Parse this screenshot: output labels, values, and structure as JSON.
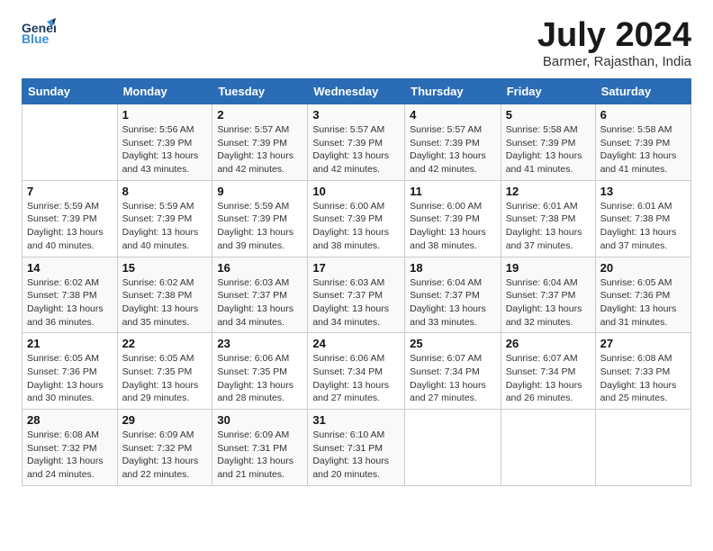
{
  "header": {
    "logo_general": "General",
    "logo_blue": "Blue",
    "month": "July 2024",
    "location": "Barmer, Rajasthan, India"
  },
  "columns": [
    "Sunday",
    "Monday",
    "Tuesday",
    "Wednesday",
    "Thursday",
    "Friday",
    "Saturday"
  ],
  "weeks": [
    [
      {
        "day": "",
        "sunrise": "",
        "sunset": "",
        "daylight": ""
      },
      {
        "day": "1",
        "sunrise": "Sunrise: 5:56 AM",
        "sunset": "Sunset: 7:39 PM",
        "daylight": "Daylight: 13 hours and 43 minutes."
      },
      {
        "day": "2",
        "sunrise": "Sunrise: 5:57 AM",
        "sunset": "Sunset: 7:39 PM",
        "daylight": "Daylight: 13 hours and 42 minutes."
      },
      {
        "day": "3",
        "sunrise": "Sunrise: 5:57 AM",
        "sunset": "Sunset: 7:39 PM",
        "daylight": "Daylight: 13 hours and 42 minutes."
      },
      {
        "day": "4",
        "sunrise": "Sunrise: 5:57 AM",
        "sunset": "Sunset: 7:39 PM",
        "daylight": "Daylight: 13 hours and 42 minutes."
      },
      {
        "day": "5",
        "sunrise": "Sunrise: 5:58 AM",
        "sunset": "Sunset: 7:39 PM",
        "daylight": "Daylight: 13 hours and 41 minutes."
      },
      {
        "day": "6",
        "sunrise": "Sunrise: 5:58 AM",
        "sunset": "Sunset: 7:39 PM",
        "daylight": "Daylight: 13 hours and 41 minutes."
      }
    ],
    [
      {
        "day": "7",
        "sunrise": "Sunrise: 5:59 AM",
        "sunset": "Sunset: 7:39 PM",
        "daylight": "Daylight: 13 hours and 40 minutes."
      },
      {
        "day": "8",
        "sunrise": "Sunrise: 5:59 AM",
        "sunset": "Sunset: 7:39 PM",
        "daylight": "Daylight: 13 hours and 40 minutes."
      },
      {
        "day": "9",
        "sunrise": "Sunrise: 5:59 AM",
        "sunset": "Sunset: 7:39 PM",
        "daylight": "Daylight: 13 hours and 39 minutes."
      },
      {
        "day": "10",
        "sunrise": "Sunrise: 6:00 AM",
        "sunset": "Sunset: 7:39 PM",
        "daylight": "Daylight: 13 hours and 38 minutes."
      },
      {
        "day": "11",
        "sunrise": "Sunrise: 6:00 AM",
        "sunset": "Sunset: 7:39 PM",
        "daylight": "Daylight: 13 hours and 38 minutes."
      },
      {
        "day": "12",
        "sunrise": "Sunrise: 6:01 AM",
        "sunset": "Sunset: 7:38 PM",
        "daylight": "Daylight: 13 hours and 37 minutes."
      },
      {
        "day": "13",
        "sunrise": "Sunrise: 6:01 AM",
        "sunset": "Sunset: 7:38 PM",
        "daylight": "Daylight: 13 hours and 37 minutes."
      }
    ],
    [
      {
        "day": "14",
        "sunrise": "Sunrise: 6:02 AM",
        "sunset": "Sunset: 7:38 PM",
        "daylight": "Daylight: 13 hours and 36 minutes."
      },
      {
        "day": "15",
        "sunrise": "Sunrise: 6:02 AM",
        "sunset": "Sunset: 7:38 PM",
        "daylight": "Daylight: 13 hours and 35 minutes."
      },
      {
        "day": "16",
        "sunrise": "Sunrise: 6:03 AM",
        "sunset": "Sunset: 7:37 PM",
        "daylight": "Daylight: 13 hours and 34 minutes."
      },
      {
        "day": "17",
        "sunrise": "Sunrise: 6:03 AM",
        "sunset": "Sunset: 7:37 PM",
        "daylight": "Daylight: 13 hours and 34 minutes."
      },
      {
        "day": "18",
        "sunrise": "Sunrise: 6:04 AM",
        "sunset": "Sunset: 7:37 PM",
        "daylight": "Daylight: 13 hours and 33 minutes."
      },
      {
        "day": "19",
        "sunrise": "Sunrise: 6:04 AM",
        "sunset": "Sunset: 7:37 PM",
        "daylight": "Daylight: 13 hours and 32 minutes."
      },
      {
        "day": "20",
        "sunrise": "Sunrise: 6:05 AM",
        "sunset": "Sunset: 7:36 PM",
        "daylight": "Daylight: 13 hours and 31 minutes."
      }
    ],
    [
      {
        "day": "21",
        "sunrise": "Sunrise: 6:05 AM",
        "sunset": "Sunset: 7:36 PM",
        "daylight": "Daylight: 13 hours and 30 minutes."
      },
      {
        "day": "22",
        "sunrise": "Sunrise: 6:05 AM",
        "sunset": "Sunset: 7:35 PM",
        "daylight": "Daylight: 13 hours and 29 minutes."
      },
      {
        "day": "23",
        "sunrise": "Sunrise: 6:06 AM",
        "sunset": "Sunset: 7:35 PM",
        "daylight": "Daylight: 13 hours and 28 minutes."
      },
      {
        "day": "24",
        "sunrise": "Sunrise: 6:06 AM",
        "sunset": "Sunset: 7:34 PM",
        "daylight": "Daylight: 13 hours and 27 minutes."
      },
      {
        "day": "25",
        "sunrise": "Sunrise: 6:07 AM",
        "sunset": "Sunset: 7:34 PM",
        "daylight": "Daylight: 13 hours and 27 minutes."
      },
      {
        "day": "26",
        "sunrise": "Sunrise: 6:07 AM",
        "sunset": "Sunset: 7:34 PM",
        "daylight": "Daylight: 13 hours and 26 minutes."
      },
      {
        "day": "27",
        "sunrise": "Sunrise: 6:08 AM",
        "sunset": "Sunset: 7:33 PM",
        "daylight": "Daylight: 13 hours and 25 minutes."
      }
    ],
    [
      {
        "day": "28",
        "sunrise": "Sunrise: 6:08 AM",
        "sunset": "Sunset: 7:32 PM",
        "daylight": "Daylight: 13 hours and 24 minutes."
      },
      {
        "day": "29",
        "sunrise": "Sunrise: 6:09 AM",
        "sunset": "Sunset: 7:32 PM",
        "daylight": "Daylight: 13 hours and 22 minutes."
      },
      {
        "day": "30",
        "sunrise": "Sunrise: 6:09 AM",
        "sunset": "Sunset: 7:31 PM",
        "daylight": "Daylight: 13 hours and 21 minutes."
      },
      {
        "day": "31",
        "sunrise": "Sunrise: 6:10 AM",
        "sunset": "Sunset: 7:31 PM",
        "daylight": "Daylight: 13 hours and 20 minutes."
      },
      {
        "day": "",
        "sunrise": "",
        "sunset": "",
        "daylight": ""
      },
      {
        "day": "",
        "sunrise": "",
        "sunset": "",
        "daylight": ""
      },
      {
        "day": "",
        "sunrise": "",
        "sunset": "",
        "daylight": ""
      }
    ]
  ]
}
